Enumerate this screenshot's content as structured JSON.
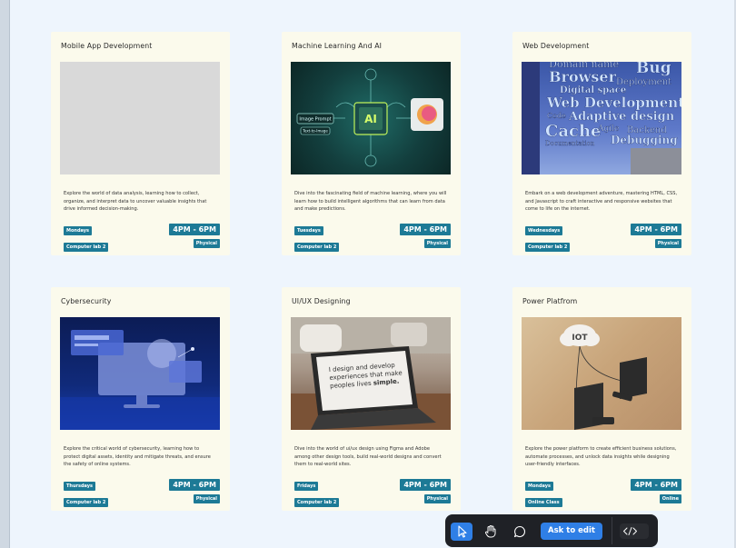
{
  "cards": [
    {
      "title": "Mobile App Development",
      "description": "Explore the world of data analysis, learning how to collect, organize, and interpret data to  uncover valuable insights that drive informed decision-making.",
      "day": "Mondays",
      "room": "Computer lab 2",
      "time": "4PM - 6PM",
      "mode": "Physical",
      "image": "blank-placeholder-image"
    },
    {
      "title": "Machine Learning And AI",
      "description": "Dive into the fascinating field of machine learning, where you will learn how to build intelligent algorithms that can learn from data and make predictions.",
      "day": "Tuesdays",
      "room": "Computer lab 2",
      "time": "4PM - 6PM",
      "mode": "Physical",
      "image": "ai-chip-illustration",
      "image_labels": [
        "Image Prompt",
        "Text-to-Image",
        "AI"
      ]
    },
    {
      "title": "Web Development",
      "description": "Embark on a web development adventure, mastering HTML, CSS, and Javascript to craft interactive and responsive websites that come to life on the internet.",
      "day": "Wednesdays",
      "room": "Computer lab 2",
      "time": "4PM - 6PM",
      "mode": "Physical",
      "image": "web-development-word-cloud",
      "image_words": [
        "Domain name",
        "Bug",
        "Browser",
        "Deployment",
        "Digital space",
        "Web Development",
        "Code",
        "Adaptive design",
        "Cache",
        "Agile",
        "Backend",
        "Documentation",
        "Debugging"
      ]
    },
    {
      "title": "Cybersecurity",
      "description": "Explore the critical world of cybersecurity, learning how to protect digital assets, identity and mitigate threats, and ensure the safety of online systems.",
      "day": "Thursdays",
      "room": "Computer lab 2",
      "time": "4PM - 6PM",
      "mode": "Physical",
      "image": "cybersecurity-monitor-illustration"
    },
    {
      "title": "UI/UX Designing",
      "description": "Dive into the world of ui/ux design using Figma and Adobe among other design tools, build real-world designs and convert them to real-world sites.",
      "day": "Fridays",
      "room": "Computer lab 2",
      "time": "4PM - 6PM",
      "mode": "Physical",
      "image": "laptop-on-table-photo",
      "image_labels": [
        "I design and develop experiences that make peoples lives",
        "simple."
      ]
    },
    {
      "title": "Power Platfrom",
      "description": "Explore the power platform to create efficient business solutions, automate processes, and unlock data insights while designing user-friendly interfaces.",
      "day": "Mondays",
      "room": "Online Class",
      "time": "4PM - 6PM",
      "mode": "Online",
      "image": "iot-cloud-devices-illustration",
      "image_labels": [
        "IOT"
      ]
    }
  ],
  "toolbar": {
    "edit_label": "Ask to edit",
    "tools": [
      "select-cursor-icon",
      "hand-icon",
      "comment-icon",
      "code-icon"
    ]
  },
  "colors": {
    "page_background": "#eef5fd",
    "card_background": "#fbfaec",
    "badge": "#1d7a96",
    "toolbar": "#1f2126",
    "toolbar_accent": "#2f7fe6"
  }
}
